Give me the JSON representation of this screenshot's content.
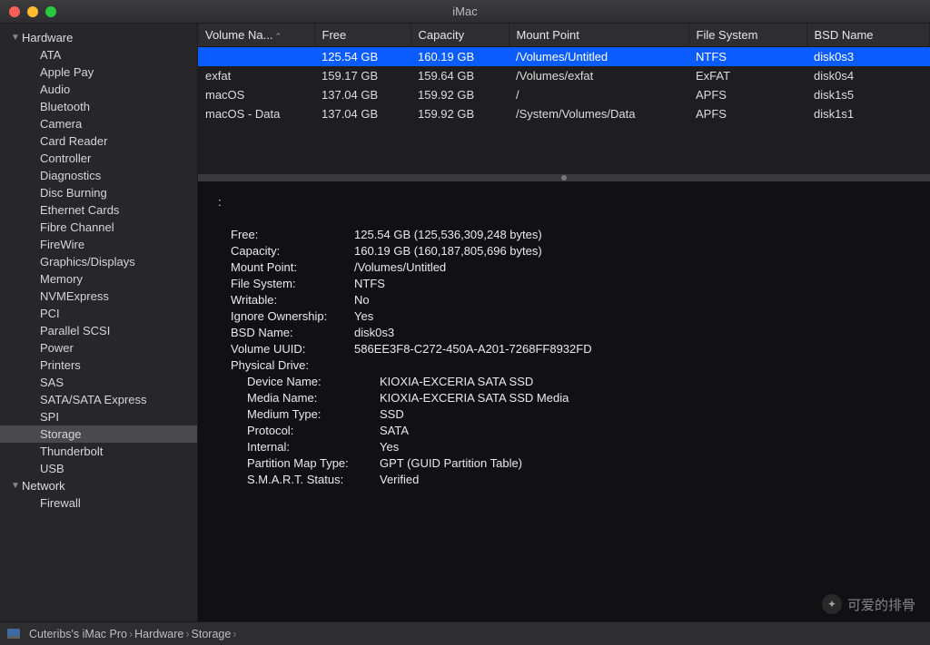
{
  "window": {
    "title": "iMac"
  },
  "sidebar": {
    "sections": [
      {
        "label": "Hardware",
        "items": [
          "ATA",
          "Apple Pay",
          "Audio",
          "Bluetooth",
          "Camera",
          "Card Reader",
          "Controller",
          "Diagnostics",
          "Disc Burning",
          "Ethernet Cards",
          "Fibre Channel",
          "FireWire",
          "Graphics/Displays",
          "Memory",
          "NVMExpress",
          "PCI",
          "Parallel SCSI",
          "Power",
          "Printers",
          "SAS",
          "SATA/SATA Express",
          "SPI",
          "Storage",
          "Thunderbolt",
          "USB"
        ],
        "selected": "Storage"
      },
      {
        "label": "Network",
        "items": [
          "Firewall"
        ]
      }
    ]
  },
  "table": {
    "columns": [
      "Volume Na...",
      "Free",
      "Capacity",
      "Mount Point",
      "File System",
      "BSD Name"
    ],
    "rows": [
      {
        "name": "",
        "free": "125.54 GB",
        "capacity": "160.19 GB",
        "mount": "/Volumes/Untitled",
        "fs": "NTFS",
        "bsd": "disk0s3",
        "selected": true
      },
      {
        "name": "exfat",
        "free": "159.17 GB",
        "capacity": "159.64 GB",
        "mount": "/Volumes/exfat",
        "fs": "ExFAT",
        "bsd": "disk0s4"
      },
      {
        "name": "macOS",
        "free": "137.04 GB",
        "capacity": "159.92 GB",
        "mount": "/",
        "fs": "APFS",
        "bsd": "disk1s5"
      },
      {
        "name": "macOS - Data",
        "free": "137.04 GB",
        "capacity": "159.92 GB",
        "mount": "/System/Volumes/Data",
        "fs": "APFS",
        "bsd": "disk1s1"
      }
    ]
  },
  "details": {
    "top_colon": ":",
    "rows": [
      {
        "k": "Free:",
        "v": "125.54 GB (125,536,309,248 bytes)"
      },
      {
        "k": "Capacity:",
        "v": "160.19 GB (160,187,805,696 bytes)"
      },
      {
        "k": "Mount Point:",
        "v": "/Volumes/Untitled"
      },
      {
        "k": "File System:",
        "v": "NTFS"
      },
      {
        "k": "Writable:",
        "v": "No"
      },
      {
        "k": "Ignore Ownership:",
        "v": "Yes"
      },
      {
        "k": "BSD Name:",
        "v": "disk0s3"
      },
      {
        "k": "Volume UUID:",
        "v": "586EE3F8-C272-450A-A201-7268FF8932FD"
      }
    ],
    "physical_label": "Physical Drive:",
    "physical": [
      {
        "k": "Device Name:",
        "v": "KIOXIA-EXCERIA SATA SSD"
      },
      {
        "k": "Media Name:",
        "v": "KIOXIA-EXCERIA SATA SSD Media"
      },
      {
        "k": "Medium Type:",
        "v": "SSD"
      },
      {
        "k": "Protocol:",
        "v": "SATA"
      },
      {
        "k": "Internal:",
        "v": "Yes"
      },
      {
        "k": "Partition Map Type:",
        "v": "GPT (GUID Partition Table)"
      },
      {
        "k": "S.M.A.R.T. Status:",
        "v": "Verified"
      }
    ]
  },
  "pathbar": {
    "segments": [
      "Cuteribs's iMac Pro",
      "Hardware",
      "Storage"
    ]
  },
  "watermark": "可爱的排骨"
}
